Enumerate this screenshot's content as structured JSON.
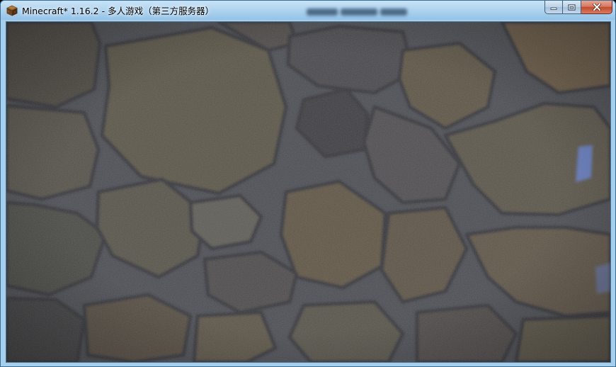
{
  "window": {
    "title": "Minecraft* 1.16.2 - 多人游戏（第三方服务器）",
    "app_icon": "minecraft-grass-block-icon"
  },
  "caption_buttons": {
    "minimize_icon": "minimize-icon",
    "maximize_icon": "maximize-icon",
    "close_icon": "close-icon"
  },
  "game": {
    "background": "stone-texture-loading-screen"
  },
  "colors": {
    "titlebar_top": "#c9e3f6",
    "titlebar_bottom": "#a6cfee",
    "close_button": "#c24b30",
    "mortar": "#4a4c52",
    "stone_brown": "#5d5648",
    "stone_dark": "#3e3f45",
    "blue_smudge": "#6f86c9"
  }
}
